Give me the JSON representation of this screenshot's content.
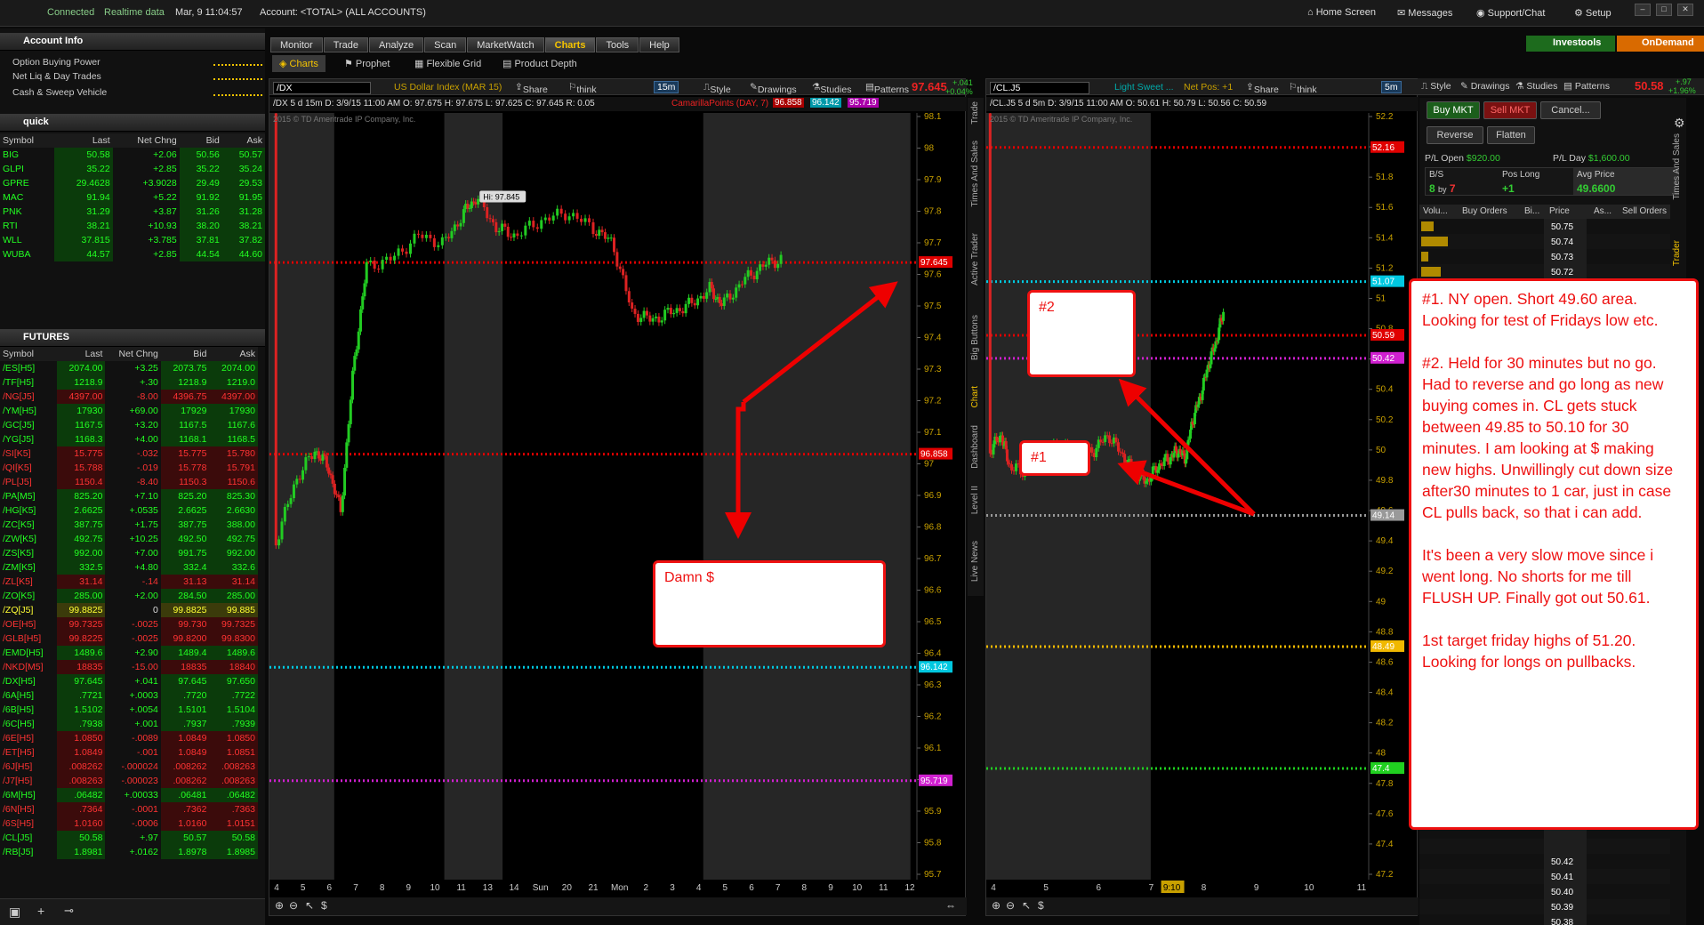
{
  "topbar": {
    "status": "Connected",
    "data": "Realtime data",
    "datetime": "Mar, 9  11:04:57",
    "account": "Account: <TOTAL> (ALL ACCOUNTS)",
    "home": "Home Screen",
    "messages": "Messages",
    "support": "Support/Chat",
    "setup": "Setup",
    "investools": "Investools",
    "ondemand": "OnDemand"
  },
  "tabs": [
    "Monitor",
    "Trade",
    "Analyze",
    "Scan",
    "MarketWatch",
    "Charts",
    "Tools",
    "Help"
  ],
  "subtabs": {
    "charts": "Charts",
    "prophet": "Prophet",
    "flexible": "Flexible Grid",
    "depth": "Product Depth"
  },
  "account_info": {
    "title": "Account Info",
    "rows": [
      "Option Buying Power",
      "Net Liq & Day Trades",
      "Cash & Sweep Vehicle"
    ]
  },
  "quick": {
    "title": "quick",
    "headers": [
      "Symbol",
      "Last",
      "Net Chng",
      "Bid",
      "Ask"
    ],
    "rows": [
      [
        "BIG",
        "50.58",
        "+2.06",
        "50.56",
        "50.57"
      ],
      [
        "GLPI",
        "35.22",
        "+2.85",
        "35.22",
        "35.24"
      ],
      [
        "GPRE",
        "29.4628",
        "+3.9028",
        "29.49",
        "29.53"
      ],
      [
        "MAC",
        "91.94",
        "+5.22",
        "91.92",
        "91.95"
      ],
      [
        "PNK",
        "31.29",
        "+3.87",
        "31.26",
        "31.28"
      ],
      [
        "RTI",
        "38.21",
        "+10.93",
        "38.20",
        "38.21"
      ],
      [
        "WLL",
        "37.815",
        "+3.785",
        "37.81",
        "37.82"
      ],
      [
        "WUBA",
        "44.57",
        "+2.85",
        "44.54",
        "44.60"
      ]
    ]
  },
  "futures": {
    "title": "FUTURES",
    "headers": [
      "Symbol",
      "Last",
      "Net Chng",
      "Bid",
      "Ask"
    ],
    "rows": [
      [
        "/ES[H5]",
        "2074.00",
        "+3.25",
        "2073.75",
        "2074.00"
      ],
      [
        "/TF[H5]",
        "1218.9",
        "+.30",
        "1218.9",
        "1219.0"
      ],
      [
        "/NG[J5]",
        "4397.00",
        "-8.00",
        "4396.75",
        "4397.00"
      ],
      [
        "/YM[H5]",
        "17930",
        "+69.00",
        "17929",
        "17930"
      ],
      [
        "/GC[J5]",
        "1167.5",
        "+3.20",
        "1167.5",
        "1167.6"
      ],
      [
        "/YG[J5]",
        "1168.3",
        "+4.00",
        "1168.1",
        "1168.5"
      ],
      [
        "/SI[K5]",
        "15.775",
        "-.032",
        "15.775",
        "15.780"
      ],
      [
        "/QI[K5]",
        "15.788",
        "-.019",
        "15.778",
        "15.791"
      ],
      [
        "/PL[J5]",
        "1150.4",
        "-8.40",
        "1150.3",
        "1150.6"
      ],
      [
        "/PA[M5]",
        "825.20",
        "+7.10",
        "825.20",
        "825.30"
      ],
      [
        "/HG[K5]",
        "2.6625",
        "+.0535",
        "2.6625",
        "2.6630"
      ],
      [
        "/ZC[K5]",
        "387.75",
        "+1.75",
        "387.75",
        "388.00"
      ],
      [
        "/ZW[K5]",
        "492.75",
        "+10.25",
        "492.50",
        "492.75"
      ],
      [
        "/ZS[K5]",
        "992.00",
        "+7.00",
        "991.75",
        "992.00"
      ],
      [
        "/ZM[K5]",
        "332.5",
        "+4.80",
        "332.4",
        "332.6"
      ],
      [
        "/ZL[K5]",
        "31.14",
        "-.14",
        "31.13",
        "31.14"
      ],
      [
        "/ZO[K5]",
        "285.00",
        "+2.00",
        "284.50",
        "285.00"
      ],
      [
        "/ZQ[J5]",
        "99.8825",
        "0",
        "99.8825",
        "99.885"
      ],
      [
        "/OE[H5]",
        "99.7325",
        "-.0025",
        "99.730",
        "99.7325"
      ],
      [
        "/GLB[H5]",
        "99.8225",
        "-.0025",
        "99.8200",
        "99.8300"
      ],
      [
        "/EMD[H5]",
        "1489.6",
        "+2.90",
        "1489.4",
        "1489.6"
      ],
      [
        "/NKD[M5]",
        "18835",
        "-15.00",
        "18835",
        "18840"
      ],
      [
        "/DX[H5]",
        "97.645",
        "+.041",
        "97.645",
        "97.650"
      ],
      [
        "/6A[H5]",
        ".7721",
        "+.0003",
        ".7720",
        ".7722"
      ],
      [
        "/6B[H5]",
        "1.5102",
        "+.0054",
        "1.5101",
        "1.5104"
      ],
      [
        "/6C[H5]",
        ".7938",
        "+.001",
        ".7937",
        ".7939"
      ],
      [
        "/6E[H5]",
        "1.0850",
        "-.0089",
        "1.0849",
        "1.0850"
      ],
      [
        "/ET[H5]",
        "1.0849",
        "-.001",
        "1.0849",
        "1.0851"
      ],
      [
        "/6J[H5]",
        ".008262",
        "-.000024",
        ".008262",
        ".008263"
      ],
      [
        "/J7[H5]",
        ".008263",
        "-.000023",
        ".008262",
        ".008263"
      ],
      [
        "/6M[H5]",
        ".06482",
        "+.00033",
        ".06481",
        ".06482"
      ],
      [
        "/6N[H5]",
        ".7364",
        "-.0001",
        ".7362",
        ".7363"
      ],
      [
        "/6S[H5]",
        "1.0160",
        "-.0006",
        "1.0160",
        "1.0151"
      ],
      [
        "/CL[J5]",
        "50.58",
        "+.97",
        "50.57",
        "50.58"
      ],
      [
        "/RB[J5]",
        "1.8981",
        "+.0162",
        "1.8978",
        "1.8985"
      ]
    ]
  },
  "chart1": {
    "symbol": "/DX",
    "desc": "US Dollar Index (MAR 15)",
    "price": "97.645",
    "chg": "+.041",
    "pct": "+0.04%",
    "period": "15m",
    "info": "/DX 5 d 15m  D: 3/9/15 11:00 AM  O: 97.675  H: 97.675  L: 97.625  C: 97.645  R: 0.05",
    "study": "CamarillaPoints (DAY, 7)",
    "studyvals": [
      "96.858",
      "96.142",
      "95.719"
    ],
    "copyright": "2015 © TD Ameritrade IP Company, Inc.",
    "hi": "Hi: 97.845",
    "yticks": [
      "98.1",
      "98",
      "97.9",
      "97.8",
      "97.7",
      "97.6",
      "97.5",
      "97.4",
      "97.3",
      "97.2",
      "97.1",
      "97",
      "96.9",
      "96.8",
      "96.7",
      "96.6",
      "96.5",
      "96.4",
      "96.3",
      "96.2",
      "96.1",
      "96",
      "95.9",
      "95.8",
      "95.7"
    ],
    "xticks": [
      "4",
      "5",
      "6",
      "7",
      "8",
      "9",
      "10",
      "11",
      "13",
      "14",
      "Sun",
      "20",
      "21",
      "Mon",
      "2",
      "3",
      "4",
      "5",
      "6",
      "7",
      "8",
      "9",
      "10",
      "11",
      "12"
    ],
    "levels": [
      {
        "label": "97.645",
        "color": "#e00000"
      },
      {
        "label": "96.858",
        "color": "#e00000"
      },
      {
        "label": "96.142",
        "color": "#00c8e0"
      },
      {
        "label": "95.719",
        "color": "#d020d0"
      }
    ]
  },
  "chart2": {
    "symbol": "/CL.J5",
    "desc": "Light Sweet ...",
    "pos": "Net Pos: +1",
    "price": "50.58",
    "chg": "+.97",
    "pct": "+1.96%",
    "period": "5m",
    "info": "/CL.J5 5 d 5m  D: 3/9/15 11:00 AM  O: 50.61  H: 50.79  L: 50.56  C: 50.59",
    "copyright": "2015 © TD Ameritrade IP Company, Inc.",
    "yticks": [
      "52.2",
      "52",
      "51.8",
      "51.6",
      "51.4",
      "51.2",
      "51",
      "50.8",
      "50.6",
      "50.4",
      "50.2",
      "50",
      "49.8",
      "49.6",
      "49.4",
      "49.2",
      "49",
      "48.8",
      "48.6",
      "48.4",
      "48.2",
      "48",
      "47.8",
      "47.6",
      "47.4",
      "47.2"
    ],
    "xticks": [
      "4",
      "5",
      "6",
      "7",
      "8",
      "9",
      "10",
      "11"
    ],
    "xhl": "9:10",
    "levels": [
      {
        "label": "52.16",
        "color": "#e00000"
      },
      {
        "label": "51.07",
        "color": "#00c8e0"
      },
      {
        "label": "50.59",
        "color": "#e00000"
      },
      {
        "label": "50.42",
        "color": "#d020d0"
      },
      {
        "label": "49.14",
        "color": "#999999"
      },
      {
        "label": "48.49",
        "color": "#f0b800"
      },
      {
        "label": "47.4",
        "color": "#20d020"
      }
    ]
  },
  "toolbar": {
    "share": "Share",
    "think": "think A.I.",
    "style": "Style",
    "drawings": "Drawings",
    "studies": "Studies",
    "patterns": "Patterns"
  },
  "trader": {
    "buy": "Buy MKT",
    "sell": "Sell MKT",
    "cancel": "Cancel...",
    "reverse": "Reverse",
    "flatten": "Flatten",
    "plopen": "P/L Open",
    "plopen_val": "$920.00",
    "plday": "P/L Day",
    "plday_val": "$1,600.00",
    "bs": "B/S",
    "bs_val_a": "8",
    "bs_by": "by",
    "bs_val_b": "7",
    "poslong": "Pos Long",
    "poslong_val": "+1",
    "avgprice": "Avg Price",
    "avgprice_val": "49.6600",
    "dom_headers": [
      "Volu...",
      "Buy Orders",
      "Bi...",
      "Price",
      "As...",
      "Sell Orders"
    ],
    "dom_top": [
      "50.75",
      "50.74",
      "50.73",
      "50.72"
    ],
    "dom_bottom": [
      "50.42",
      "50.41",
      "50.40",
      "50.39",
      "50.38"
    ]
  },
  "notes": {
    "damn": "Damn $",
    "n1": "#1",
    "n2": "#2",
    "big": [
      "#1. NY open. Short 49.60 area. Looking for test of Fridays low etc.",
      "#2. Held for 30 minutes but no go. Had to reverse and go long as new buying comes in. CL gets stuck between 49.85 to 50.10 for 30 minutes. I am looking at $ making new highs. Unwillingly cut down size after30 minutes to 1 car, just in case CL pulls back, so that i can add.",
      "It's been a very slow move since i went long. No shorts for me till FLUSH UP. Finally got out 50.61.",
      "1st target friday highs of 51.20. Looking for longs on pullbacks."
    ]
  },
  "vtabs": [
    "Trade",
    "Times And Sales",
    "Active Trader",
    "Big Buttons",
    "Chart",
    "Dashboard",
    "Level II",
    "Live News"
  ]
}
